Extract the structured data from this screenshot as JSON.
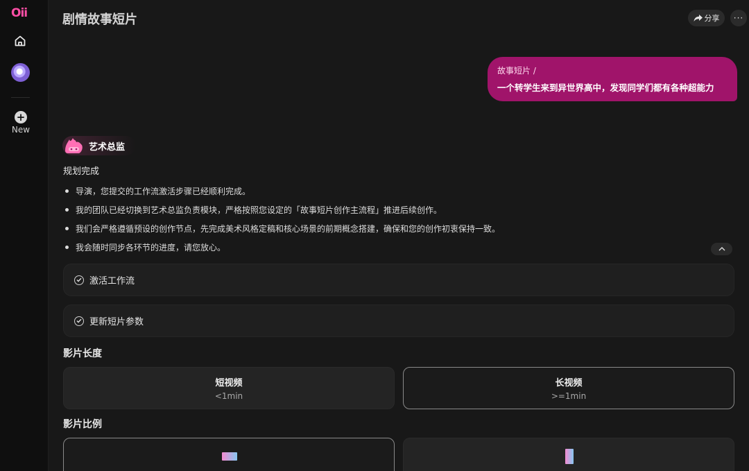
{
  "app": {
    "logo": "Oii"
  },
  "sidebar": {
    "new_label": "New",
    "icons": {
      "home": "home-icon",
      "avatar": "profile-avatar",
      "new": "plus-icon"
    }
  },
  "header": {
    "title": "剧情故事短片",
    "share_label": "分享",
    "more_label": "···"
  },
  "prompt": {
    "tag": "故事短片 /",
    "text": "一个转学生来到异世界高中，发现同学们都有各种超能力"
  },
  "agent": {
    "name": "艺术总监",
    "status": "规划完成",
    "bullets": [
      "导演，您提交的工作流激活步骤已经顺利完成。",
      "我的团队已经切换到艺术总监负责模块，严格按照您设定的「故事短片创作主流程」推进后续创作。",
      "我们会严格遵循预设的创作节点，先完成美术风格定稿和核心场景的前期概念搭建，确保和您的创作初衷保持一致。",
      "我会随时同步各环节的进度，请您放心。"
    ]
  },
  "steps": [
    {
      "label": "激活工作流"
    },
    {
      "label": "更新短片参数"
    }
  ],
  "length": {
    "title": "影片长度",
    "options": [
      {
        "title": "短视频",
        "sub": "<1min",
        "selected": false
      },
      {
        "title": "长视频",
        "sub": ">=1min",
        "selected": true
      }
    ]
  },
  "ratio": {
    "title": "影片比例",
    "options": [
      {
        "name": "landscape",
        "selected": true
      },
      {
        "name": "portrait",
        "selected": false
      }
    ]
  },
  "colors": {
    "accent": "#ff4fa6",
    "bubble": "#a0146a",
    "background": "#181818",
    "sidebar": "#0f0f0f"
  }
}
